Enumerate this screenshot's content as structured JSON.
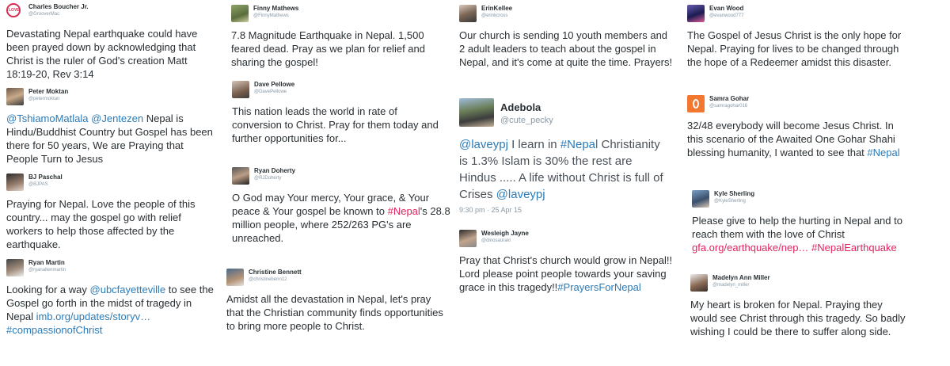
{
  "tweets": [
    {
      "name": "Charles Boucher Jr.",
      "handle": "@GrooverMac",
      "avatar_icon": "love-logo-icon",
      "segments": [
        {
          "t": "text",
          "v": "Devastating Nepal earthquake could have been prayed down by acknowledging that Christ is the ruler of God's creation Matt 18:19-20, Rev 3:14"
        }
      ]
    },
    {
      "name": "Peter Moktan",
      "handle": "@petermoktan",
      "avatar_icon": "user-photo-icon",
      "segments": [
        {
          "t": "link",
          "v": "@TshiamoMatlala"
        },
        {
          "t": "text",
          "v": " "
        },
        {
          "t": "link",
          "v": "@Jentezen"
        },
        {
          "t": "text",
          "v": "  Nepal is Hindu/Buddhist Country but Gospel has been there for 50 years, We are Praying that People Turn to Jesus"
        }
      ]
    },
    {
      "name": "BJ Paschal",
      "handle": "@BJPAS",
      "avatar_icon": "user-photo-icon",
      "segments": [
        {
          "t": "text",
          "v": "Praying for Nepal. Love the people of this country... may the gospel go with relief workers to help those affected by the earthquake."
        }
      ]
    },
    {
      "name": "Ryan Martin",
      "handle": "@ryanallenmartin",
      "avatar_icon": "user-photo-icon",
      "segments": [
        {
          "t": "text",
          "v": "Looking for a way "
        },
        {
          "t": "link",
          "v": "@ubcfayetteville"
        },
        {
          "t": "text",
          "v": " to see the Gospel go forth in the midst of tragedy in Nepal "
        },
        {
          "t": "link",
          "v": "imb.org/updates/storyv…"
        },
        {
          "t": "text",
          "v": " "
        },
        {
          "t": "link",
          "v": "#compassionofChrist"
        }
      ]
    },
    {
      "name": "Finny Mathews",
      "handle": "@FinnyMathews",
      "avatar_icon": "user-photo-icon",
      "segments": [
        {
          "t": "text",
          "v": "7.8 Magnitude Earthquake in Nepal. 1,500 feared dead. Pray as we plan for relief and sharing the gospel!"
        }
      ]
    },
    {
      "name": "Dave Pellowe",
      "handle": "@DavePellowe",
      "avatar_icon": "user-photo-icon",
      "segments": [
        {
          "t": "text",
          "v": "This nation leads the world in rate of conversion to Christ. Pray for them today and further opportunities for..."
        }
      ]
    },
    {
      "name": "Ryan Doherty",
      "handle": "@RJDoherty",
      "avatar_icon": "user-photo-icon",
      "segments": [
        {
          "t": "text",
          "v": "O God may Your mercy, Your grace, & Your peace & Your gospel be known to "
        },
        {
          "t": "hash",
          "v": "#Nepal"
        },
        {
          "t": "text",
          "v": "'s 28.8 million people, where 252/263 PG's are unreached."
        }
      ]
    },
    {
      "name": "Christine Bennett",
      "handle": "@christinebenn12",
      "avatar_icon": "user-photo-icon",
      "segments": [
        {
          "t": "text",
          "v": "Amidst all the devastation in Nepal, let's pray that the Christian community finds opportunities to bring more people to Christ."
        }
      ]
    },
    {
      "name": "ErinKellee",
      "handle": "@erinkcross",
      "avatar_icon": "user-photo-icon",
      "segments": [
        {
          "t": "text",
          "v": "Our church is sending 10 youth members and 2 adult leaders to teach about the gospel in Nepal, and it's come at quite the time. Prayers!"
        }
      ]
    },
    {
      "name": "Adebola",
      "handle": "@cute_pecky",
      "avatar_icon": "user-photo-icon",
      "time": "9:30 pm · 25 Apr 15",
      "segments": [
        {
          "t": "link",
          "v": "@laveypj"
        },
        {
          "t": "text",
          "v": " I learn in "
        },
        {
          "t": "link",
          "v": "#Nepal"
        },
        {
          "t": "text",
          "v": " Christianity is 1.3% Islam is 30% the rest are Hindus ..... A life without Christ is full of Crises "
        },
        {
          "t": "link",
          "v": "@laveypj"
        }
      ]
    },
    {
      "name": "Wesleigh Jayne",
      "handle": "@dinosaurakl",
      "avatar_icon": "user-photo-icon",
      "segments": [
        {
          "t": "text",
          "v": "Pray that Christ's church would grow in Nepal!! Lord please point people towards your saving grace in this tragedy!!"
        },
        {
          "t": "link",
          "v": "#PrayersForNepal"
        }
      ]
    },
    {
      "name": "Evan Wood",
      "handle": "@evanwood777",
      "avatar_icon": "user-photo-icon",
      "segments": [
        {
          "t": "text",
          "v": "The Gospel of Jesus Christ is the only hope for Nepal. Praying for lives to be changed through the hope of a Redeemer amidst this disaster."
        }
      ]
    },
    {
      "name": "Samra Gohar",
      "handle": "@samragohar016",
      "avatar_icon": "orange-logo-icon",
      "segments": [
        {
          "t": "text",
          "v": "32/48 everybody will become Jesus Christ. In this scenario of the Awaited One Gohar Shahi blessing humanity, I wanted to see that "
        },
        {
          "t": "link",
          "v": "#Nepal"
        }
      ]
    },
    {
      "name": "Kyle Sherling",
      "handle": "@KyleSherling",
      "avatar_icon": "user-photo-icon",
      "segments": [
        {
          "t": "text",
          "v": "Please give to help the hurting in Nepal and to reach them with the love of Christ "
        },
        {
          "t": "hash",
          "v": "gfa.org/earthquake/nep…"
        },
        {
          "t": "text",
          "v": " "
        },
        {
          "t": "hash",
          "v": "#NepalEarthquake"
        }
      ]
    },
    {
      "name": "Madelyn Ann Miller",
      "handle": "@madelyn_miller",
      "avatar_icon": "user-photo-icon",
      "segments": [
        {
          "t": "text",
          "v": "My heart is broken for Nepal. Praying they would see Christ through this tragedy. So badly wishing I could be there to suffer along side."
        }
      ]
    }
  ]
}
